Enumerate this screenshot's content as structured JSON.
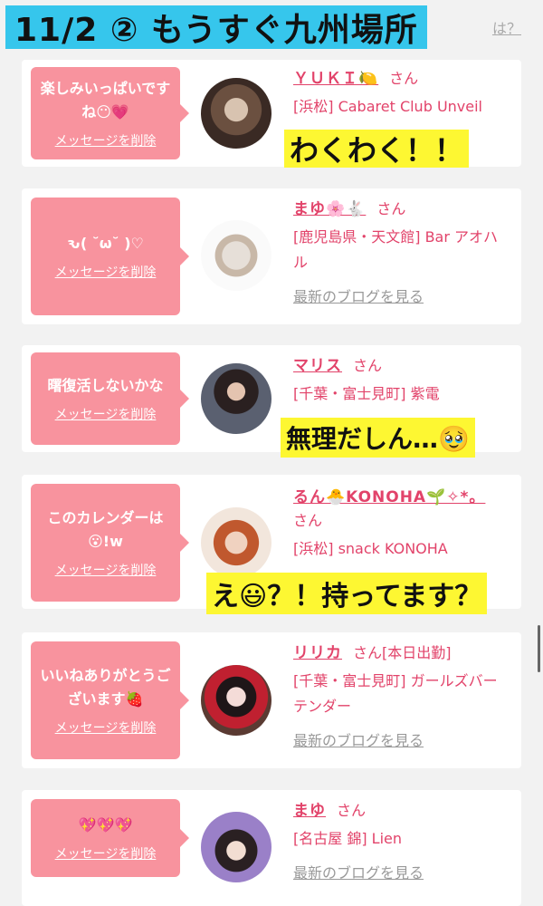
{
  "banner": "11/2 ② もうすぐ九州場所",
  "faint_link": "は？",
  "delete_label": "メッセージを削除",
  "san": "さん",
  "blog_link": "最新のブログを見る",
  "cards": [
    {
      "message": "楽しみいっぱいですね😶💗",
      "name": "ＹＵＫＩ🍋",
      "shop": "[浜松] Cabaret Club Unveil",
      "has_blog": false,
      "overlay": "わくわく！！"
    },
    {
      "message": "ԅ( ˘ω˘ )♡",
      "name": "まゆ🌸🐇",
      "shop": "[鹿児島県・天文館] Bar アオハル",
      "has_blog": true
    },
    {
      "message": "曙復活しないかな",
      "name": "マリス",
      "shop": "[千葉・富士見町] 紫電",
      "has_blog": false,
      "overlay": "無理だしん…🥹"
    },
    {
      "message": "このカレンダーは😮!w",
      "name": "るん🐣KONOHA🌱✧*。",
      "shop": "[浜松] snack KONOHA",
      "has_blog": false,
      "overlay": "え😃？！持ってます？"
    },
    {
      "message": "いいねありがとうございます🍓",
      "name": "リリカ",
      "status": "[本日出勤]",
      "shop": "[千葉・富士見町] ガールズバー テンダー",
      "has_blog": true
    },
    {
      "message": "💖💖💖",
      "name": "まゆ",
      "shop": "[名古屋 錦] Lien",
      "has_blog": true
    }
  ],
  "colors": {
    "accent": "#e2436a",
    "bubble": "#f8939e",
    "banner": "#36c6ec",
    "highlight": "#fdf732"
  }
}
